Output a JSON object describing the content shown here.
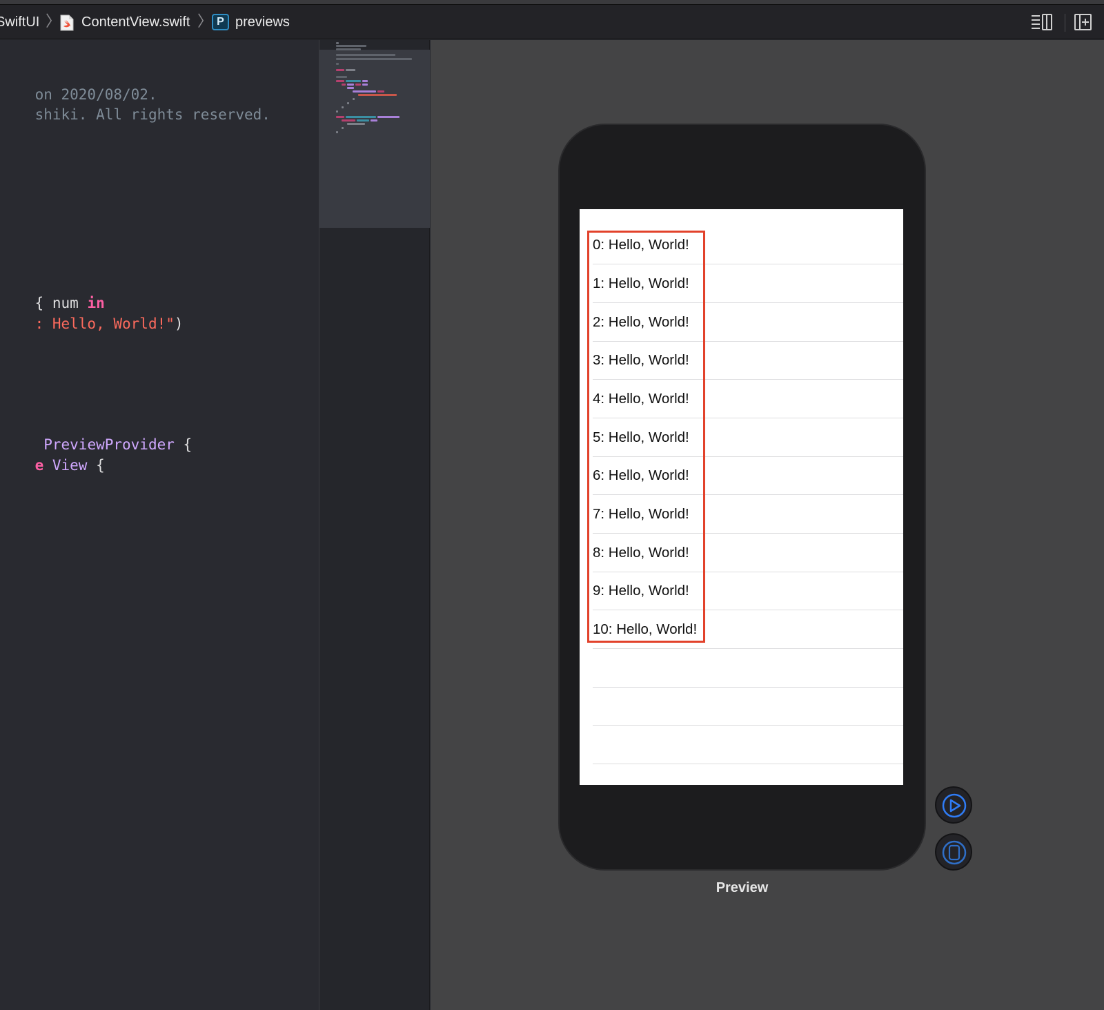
{
  "jumpbar": {
    "crumbs": [
      {
        "label": "SwiftUI"
      },
      {
        "label": "ContentView.swift",
        "icon": "swift-file-icon"
      },
      {
        "label": "previews",
        "icon": "preview-provider-icon",
        "badge": "P"
      }
    ],
    "right_icons": [
      "editor-options-icon",
      "add-editor-icon"
    ]
  },
  "editor": {
    "lines": [
      [
        {
          "t": "on 2020/08/02.",
          "c": "c-comment"
        }
      ],
      [
        {
          "t": "shiki. All rights reserved.",
          "c": "c-comment"
        }
      ],
      [
        {
          "t": "{ ",
          "c": "c-plain"
        },
        {
          "t": "num ",
          "c": "c-plain"
        },
        {
          "t": "in",
          "c": "c-kw"
        }
      ],
      [
        {
          "t": ": Hello, World!\"",
          "c": "c-str"
        },
        {
          "t": ")",
          "c": "c-plain"
        }
      ],
      [
        {
          "t": " ",
          "c": "c-plain"
        },
        {
          "t": "PreviewProvider",
          "c": "c-type"
        },
        {
          "t": " {",
          "c": "c-plain"
        }
      ],
      [
        {
          "t": "e ",
          "c": "c-kw"
        },
        {
          "t": "View",
          "c": "c-type"
        },
        {
          "t": " {",
          "c": "c-plain"
        }
      ]
    ]
  },
  "preview": {
    "rows": [
      "0: Hello, World!",
      "1: Hello, World!",
      "2: Hello, World!",
      "3: Hello, World!",
      "4: Hello, World!",
      "5: Hello, World!",
      "6: Hello, World!",
      "7: Hello, World!",
      "8: Hello, World!",
      "9: Hello, World!",
      "10: Hello, World!"
    ],
    "empty_rows": 3,
    "highlight_color": "#e2422b",
    "caption": "Preview",
    "buttons": [
      "live-preview-icon",
      "device-settings-icon"
    ]
  }
}
